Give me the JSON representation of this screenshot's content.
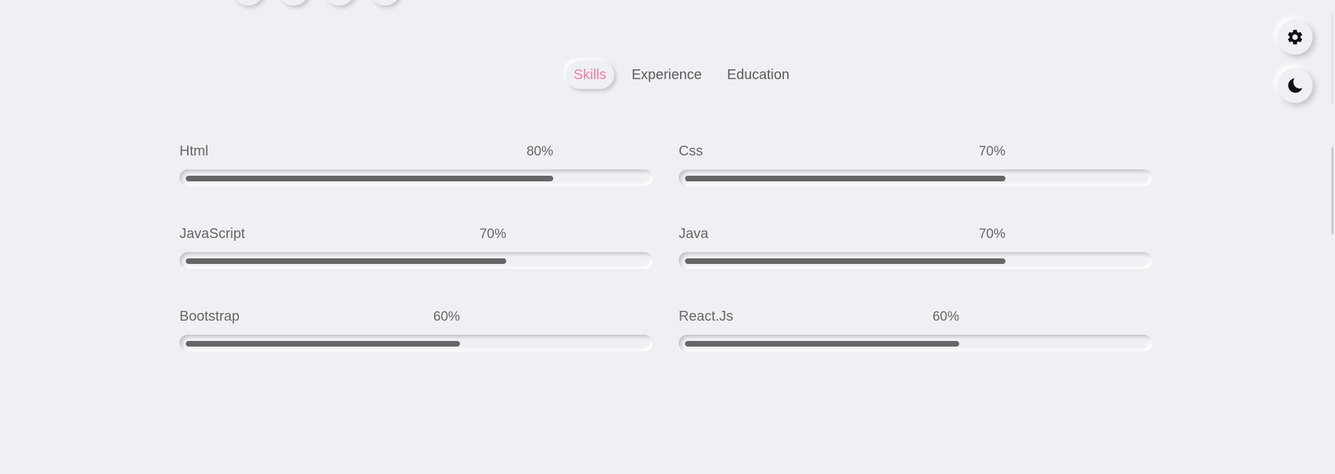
{
  "tabs": [
    {
      "label": "Skills",
      "active": true
    },
    {
      "label": "Experience",
      "active": false
    },
    {
      "label": "Education",
      "active": false
    }
  ],
  "skills": [
    {
      "name": "Html",
      "percent_label": "80%",
      "level": 0.8
    },
    {
      "name": "Css",
      "percent_label": "70%",
      "level": 0.7
    },
    {
      "name": "JavaScript",
      "percent_label": "70%",
      "level": 0.7
    },
    {
      "name": "Java",
      "percent_label": "70%",
      "level": 0.7
    },
    {
      "name": "Bootstrap",
      "percent_label": "60%",
      "level": 0.6
    },
    {
      "name": "React.Js",
      "percent_label": "60%",
      "level": 0.6
    }
  ],
  "controls": {
    "settings_icon": "gear-icon",
    "theme_icon": "moon-icon"
  },
  "colors": {
    "background": "#eff0f4",
    "accent": "#f47ba0",
    "bar_fill": "#666666",
    "text": "#5b5b5b"
  }
}
